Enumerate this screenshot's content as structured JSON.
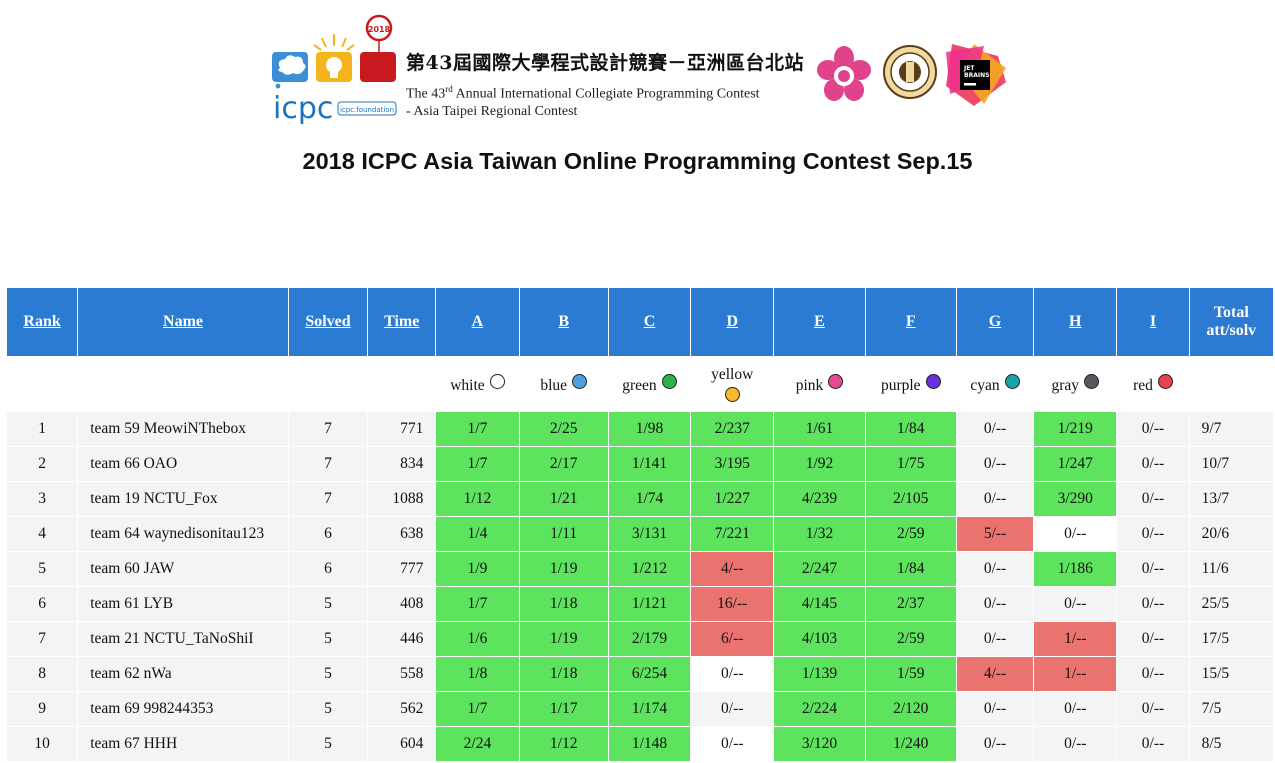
{
  "banner": {
    "icpc_text": "icpc",
    "foundation_text": "icpc.foundation",
    "balloon_year": "2018",
    "title_zh": "第43屆國際大學程式設計競賽－亞洲區台北站",
    "title_en_line1_pre": "The 43",
    "title_en_line1_sup": "rd",
    "title_en_line1_post": " Annual International Collegiate Programming Contest",
    "title_en_line2": "- Asia Taipei Regional Contest",
    "jb_text_1": "JET",
    "jb_text_2": "BRAINS"
  },
  "page_title": "2018 ICPC Asia Taiwan Online Programming Contest Sep.15",
  "columns": {
    "rank": "Rank",
    "name": "Name",
    "solved": "Solved",
    "time": "Time",
    "problems": [
      "A",
      "B",
      "C",
      "D",
      "E",
      "F",
      "G",
      "H",
      "I"
    ],
    "total_line1": "Total",
    "total_line2": "att/solv"
  },
  "balloons": [
    {
      "name": "white",
      "color": "#ffffff"
    },
    {
      "name": "blue",
      "color": "#4aa3df"
    },
    {
      "name": "green",
      "color": "#2bb34b"
    },
    {
      "name": "yellow",
      "color": "#f6b830"
    },
    {
      "name": "pink",
      "color": "#e8488f"
    },
    {
      "name": "purple",
      "color": "#6a2fe0"
    },
    {
      "name": "cyan",
      "color": "#19a3a8"
    },
    {
      "name": "gray",
      "color": "#555a60"
    },
    {
      "name": "red",
      "color": "#e84250"
    }
  ],
  "status_colors": {
    "solved": "#5ee35e",
    "failed": "#e8736f"
  },
  "rows": [
    {
      "rank": "1",
      "name": "team 59 MeowiNThebox",
      "solved": "7",
      "time": "771",
      "cells": [
        [
          "1/7",
          "ok"
        ],
        [
          "2/25",
          "ok"
        ],
        [
          "1/98",
          "ok"
        ],
        [
          "2/237",
          "ok"
        ],
        [
          "1/61",
          "ok"
        ],
        [
          "1/84",
          "ok"
        ],
        [
          "0/--",
          ""
        ],
        [
          "1/219",
          "ok"
        ],
        [
          "0/--",
          ""
        ]
      ],
      "total": "9/7"
    },
    {
      "rank": "2",
      "name": "team 66 OAO",
      "solved": "7",
      "time": "834",
      "cells": [
        [
          "1/7",
          "ok"
        ],
        [
          "2/17",
          "ok"
        ],
        [
          "1/141",
          "ok"
        ],
        [
          "3/195",
          "ok"
        ],
        [
          "1/92",
          "ok"
        ],
        [
          "1/75",
          "ok"
        ],
        [
          "0/--",
          ""
        ],
        [
          "1/247",
          "ok"
        ],
        [
          "0/--",
          ""
        ]
      ],
      "total": "10/7"
    },
    {
      "rank": "3",
      "name": "team 19 NCTU_Fox",
      "solved": "7",
      "time": "1088",
      "cells": [
        [
          "1/12",
          "ok"
        ],
        [
          "1/21",
          "ok"
        ],
        [
          "1/74",
          "ok"
        ],
        [
          "1/227",
          "ok"
        ],
        [
          "4/239",
          "ok"
        ],
        [
          "2/105",
          "ok"
        ],
        [
          "0/--",
          ""
        ],
        [
          "3/290",
          "ok"
        ],
        [
          "0/--",
          ""
        ]
      ],
      "total": "13/7"
    },
    {
      "rank": "4",
      "name": "team 64 waynedisonitau123",
      "solved": "6",
      "time": "638",
      "cells": [
        [
          "1/4",
          "ok"
        ],
        [
          "1/11",
          "ok"
        ],
        [
          "3/131",
          "ok"
        ],
        [
          "7/221",
          "ok"
        ],
        [
          "1/32",
          "ok"
        ],
        [
          "2/59",
          "ok"
        ],
        [
          "5/--",
          "bad"
        ],
        [
          "0/--",
          "none"
        ],
        [
          "0/--",
          ""
        ]
      ],
      "total": "20/6"
    },
    {
      "rank": "5",
      "name": "team 60 JAW",
      "solved": "6",
      "time": "777",
      "cells": [
        [
          "1/9",
          "ok"
        ],
        [
          "1/19",
          "ok"
        ],
        [
          "1/212",
          "ok"
        ],
        [
          "4/--",
          "bad"
        ],
        [
          "2/247",
          "ok"
        ],
        [
          "1/84",
          "ok"
        ],
        [
          "0/--",
          ""
        ],
        [
          "1/186",
          "ok"
        ],
        [
          "0/--",
          ""
        ]
      ],
      "total": "11/6"
    },
    {
      "rank": "6",
      "name": "team 61 LYB",
      "solved": "5",
      "time": "408",
      "cells": [
        [
          "1/7",
          "ok"
        ],
        [
          "1/18",
          "ok"
        ],
        [
          "1/121",
          "ok"
        ],
        [
          "16/--",
          "bad"
        ],
        [
          "4/145",
          "ok"
        ],
        [
          "2/37",
          "ok"
        ],
        [
          "0/--",
          ""
        ],
        [
          "0/--",
          ""
        ],
        [
          "0/--",
          ""
        ]
      ],
      "total": "25/5"
    },
    {
      "rank": "7",
      "name": "team 21 NCTU_TaNoShiI",
      "solved": "5",
      "time": "446",
      "cells": [
        [
          "1/6",
          "ok"
        ],
        [
          "1/19",
          "ok"
        ],
        [
          "2/179",
          "ok"
        ],
        [
          "6/--",
          "bad"
        ],
        [
          "4/103",
          "ok"
        ],
        [
          "2/59",
          "ok"
        ],
        [
          "0/--",
          ""
        ],
        [
          "1/--",
          "bad"
        ],
        [
          "0/--",
          ""
        ]
      ],
      "total": "17/5"
    },
    {
      "rank": "8",
      "name": "team 62 nWa",
      "solved": "5",
      "time": "558",
      "cells": [
        [
          "1/8",
          "ok"
        ],
        [
          "1/18",
          "ok"
        ],
        [
          "6/254",
          "ok"
        ],
        [
          "0/--",
          "none"
        ],
        [
          "1/139",
          "ok"
        ],
        [
          "1/59",
          "ok"
        ],
        [
          "4/--",
          "bad"
        ],
        [
          "1/--",
          "bad"
        ],
        [
          "0/--",
          ""
        ]
      ],
      "total": "15/5"
    },
    {
      "rank": "9",
      "name": "team 69 998244353",
      "solved": "5",
      "time": "562",
      "cells": [
        [
          "1/7",
          "ok"
        ],
        [
          "1/17",
          "ok"
        ],
        [
          "1/174",
          "ok"
        ],
        [
          "0/--",
          ""
        ],
        [
          "2/224",
          "ok"
        ],
        [
          "2/120",
          "ok"
        ],
        [
          "0/--",
          ""
        ],
        [
          "0/--",
          ""
        ],
        [
          "0/--",
          ""
        ]
      ],
      "total": "7/5"
    },
    {
      "rank": "10",
      "name": "team 67 HHH",
      "solved": "5",
      "time": "604",
      "cells": [
        [
          "2/24",
          "ok"
        ],
        [
          "1/12",
          "ok"
        ],
        [
          "1/148",
          "ok"
        ],
        [
          "0/--",
          "none"
        ],
        [
          "3/120",
          "ok"
        ],
        [
          "1/240",
          "ok"
        ],
        [
          "0/--",
          ""
        ],
        [
          "0/--",
          ""
        ],
        [
          "0/--",
          ""
        ]
      ],
      "total": "8/5"
    }
  ]
}
